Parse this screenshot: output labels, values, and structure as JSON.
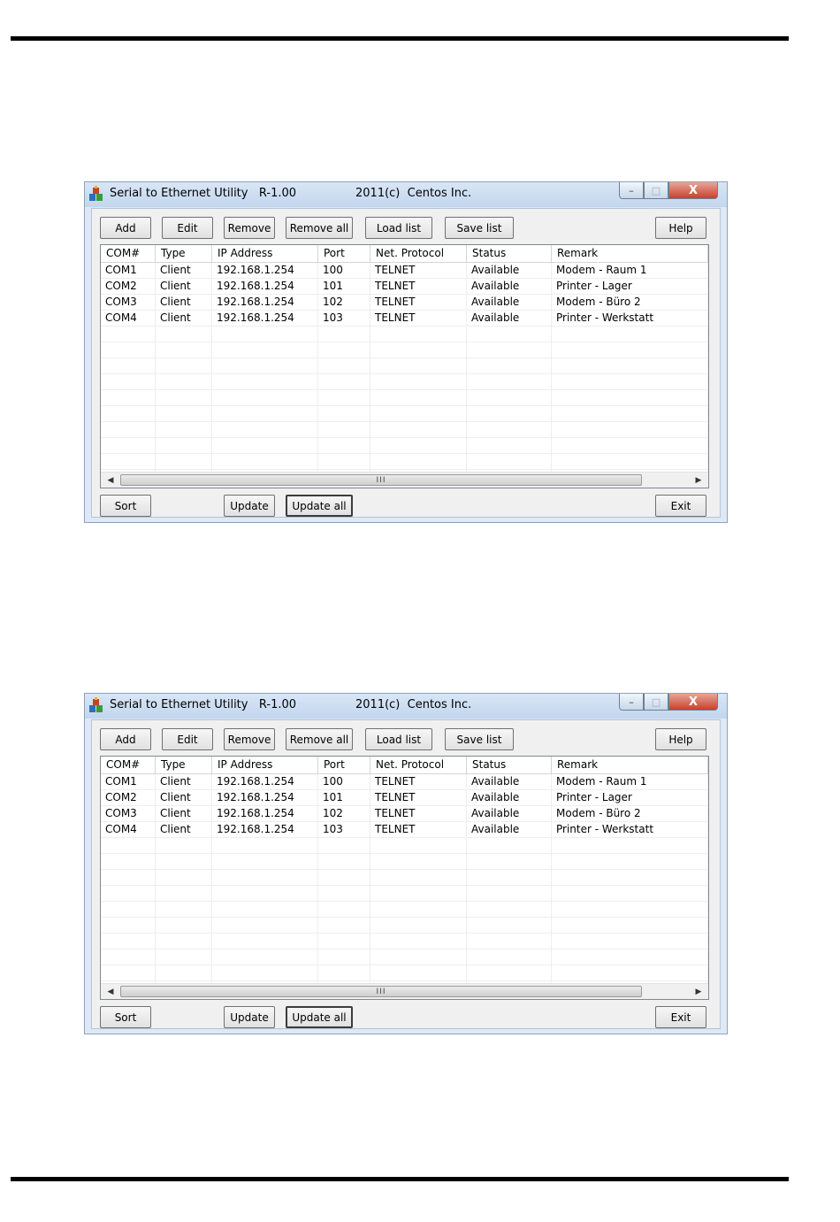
{
  "window": {
    "title": "Serial to Ethernet Utility   R-1.00",
    "copyright": "2011(c)  Centos Inc.",
    "controls": {
      "minimize": "–",
      "maximize": "□",
      "close": "X"
    }
  },
  "toolbar": {
    "add": "Add",
    "edit": "Edit",
    "remove": "Remove",
    "remove_all": "Remove all",
    "load_list": "Load list",
    "save_list": "Save list",
    "help": "Help"
  },
  "columns": [
    "COM#",
    "Type",
    "IP Address",
    "Port",
    "Net. Protocol",
    "Status",
    "Remark"
  ],
  "rows": [
    [
      "COM1",
      "Client",
      "192.168.1.254",
      "100",
      "TELNET",
      "Available",
      "Modem - Raum 1"
    ],
    [
      "COM2",
      "Client",
      "192.168.1.254",
      "101",
      "TELNET",
      "Available",
      "Printer - Lager"
    ],
    [
      "COM3",
      "Client",
      "192.168.1.254",
      "102",
      "TELNET",
      "Available",
      "Modem - Büro 2"
    ],
    [
      "COM4",
      "Client",
      "192.168.1.254",
      "103",
      "TELNET",
      "Available",
      "Printer - Werkstatt"
    ]
  ],
  "scrollbar": {
    "grip": "III"
  },
  "bottom": {
    "sort": "Sort",
    "update": "Update",
    "update_all": "Update all",
    "exit": "Exit"
  }
}
